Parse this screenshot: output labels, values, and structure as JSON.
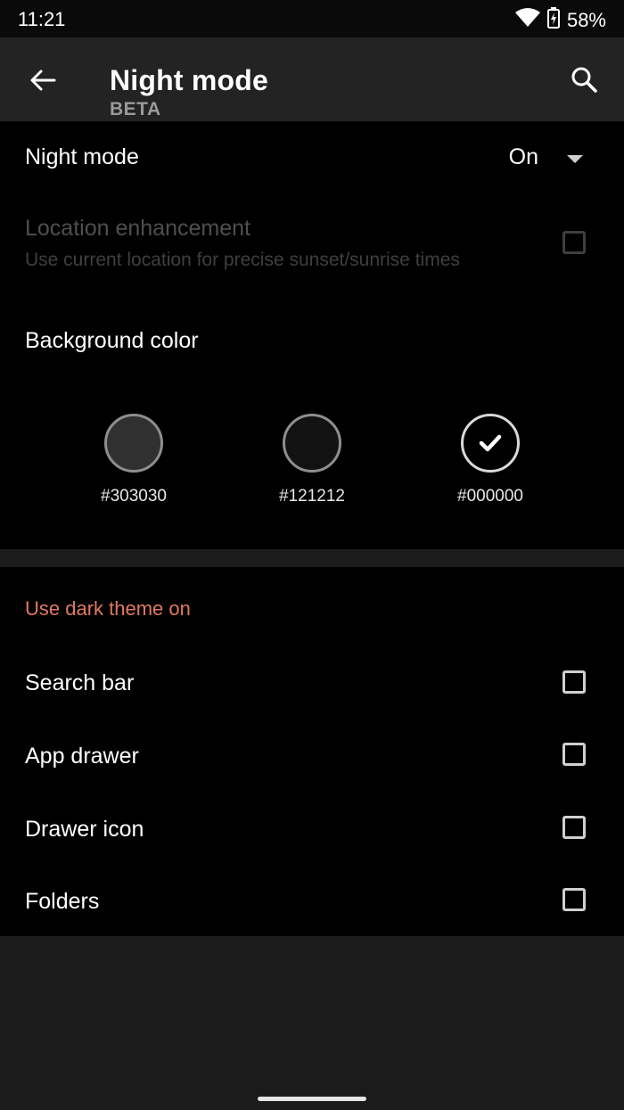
{
  "status": {
    "time": "11:21",
    "battery": "58%"
  },
  "appbar": {
    "title": "Night mode",
    "subtitle": "BETA"
  },
  "night_mode": {
    "label": "Night mode",
    "value": "On"
  },
  "location": {
    "title": "Location enhancement",
    "subtitle": "Use current location for precise sunset/sunrise times",
    "checked": false
  },
  "background": {
    "label": "Background color",
    "swatches": [
      {
        "label": "#303030",
        "color": "#303030",
        "selected": false
      },
      {
        "label": "#121212",
        "color": "#121212",
        "selected": false
      },
      {
        "label": "#000000",
        "color": "#000000",
        "selected": true
      }
    ]
  },
  "dark_theme": {
    "header": "Use dark theme on",
    "options": [
      {
        "label": "Search bar",
        "checked": false
      },
      {
        "label": "App drawer",
        "checked": false
      },
      {
        "label": "Drawer icon",
        "checked": false
      },
      {
        "label": "Folders",
        "checked": false
      }
    ]
  },
  "colors": {
    "accent": "#e07a5f",
    "background": "#000000",
    "appbar": "#232323"
  }
}
